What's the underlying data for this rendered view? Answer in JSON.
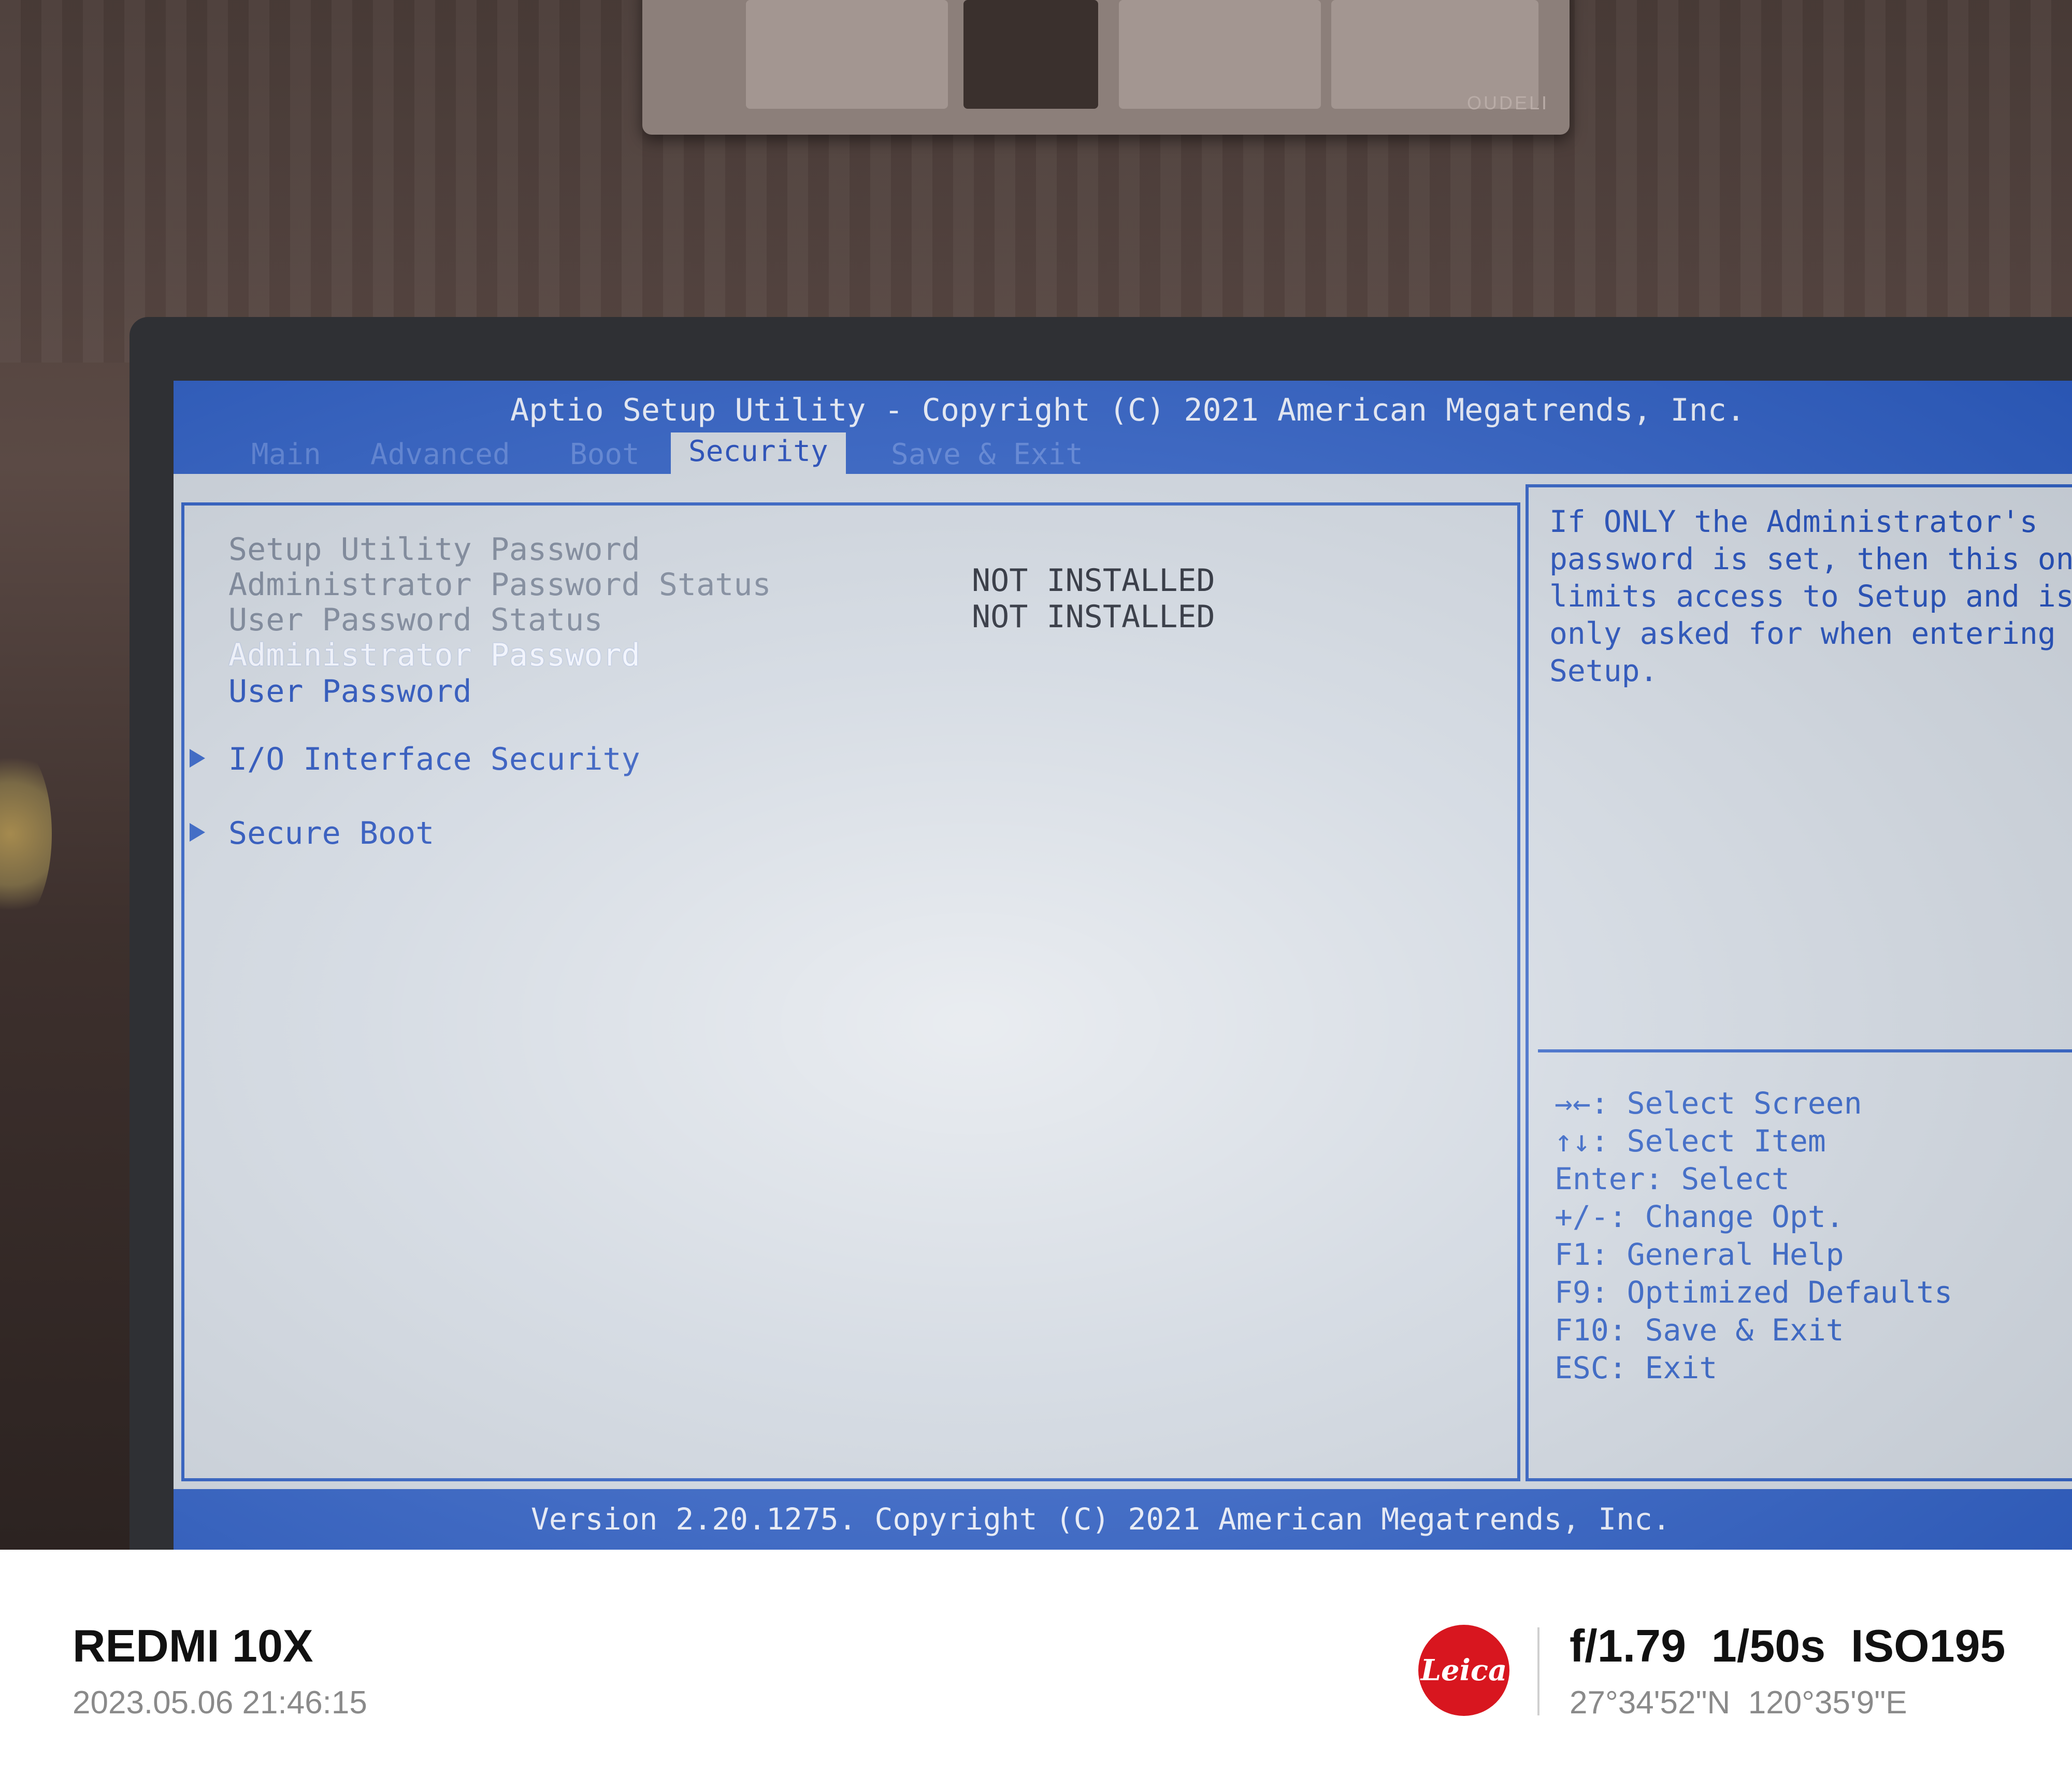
{
  "bios": {
    "title": "Aptio Setup Utility - Copyright (C) 2021 American Megatrends, Inc.",
    "tabs": {
      "main": "Main",
      "advanced": "Advanced",
      "boot": "Boot",
      "security": "Security",
      "save_exit": "Save & Exit"
    },
    "active_tab": "Security",
    "items": {
      "setup_utility_password": "Setup Utility Password",
      "admin_password_status": {
        "label": "Administrator Password Status",
        "value": "NOT INSTALLED"
      },
      "user_password_status": {
        "label": "User Password Status",
        "value": "NOT INSTALLED"
      },
      "administrator_password": "Administrator Password",
      "user_password": "User Password",
      "io_interface_security": "I/O Interface Security",
      "secure_boot": "Secure Boot"
    },
    "help_text": "If ONLY the Administrator's password is set, then this only limits access to Setup and is only asked for when entering Setup.",
    "keys": [
      "→←: Select Screen",
      "↑↓: Select Item",
      "Enter: Select",
      "+/-: Change Opt.",
      "F1: General Help",
      "F9: Optimized Defaults",
      "F10: Save & Exit",
      "ESC: Exit"
    ],
    "footer": "Version 2.20.1275. Copyright (C) 2021 American Megatrends, Inc.",
    "colors": {
      "accent": "#2d5dc2",
      "screen_bg": "#cfd6df"
    }
  },
  "photo": {
    "socket_brand": "OUDELI",
    "device_model": "REDMI 10X",
    "datetime": "2023.05.06  21:46:15",
    "brand_logo": "Leica",
    "exif": "f/1.79  1/50s  ISO195",
    "gps": "27°34'52\"N  120°35'9\"E"
  }
}
